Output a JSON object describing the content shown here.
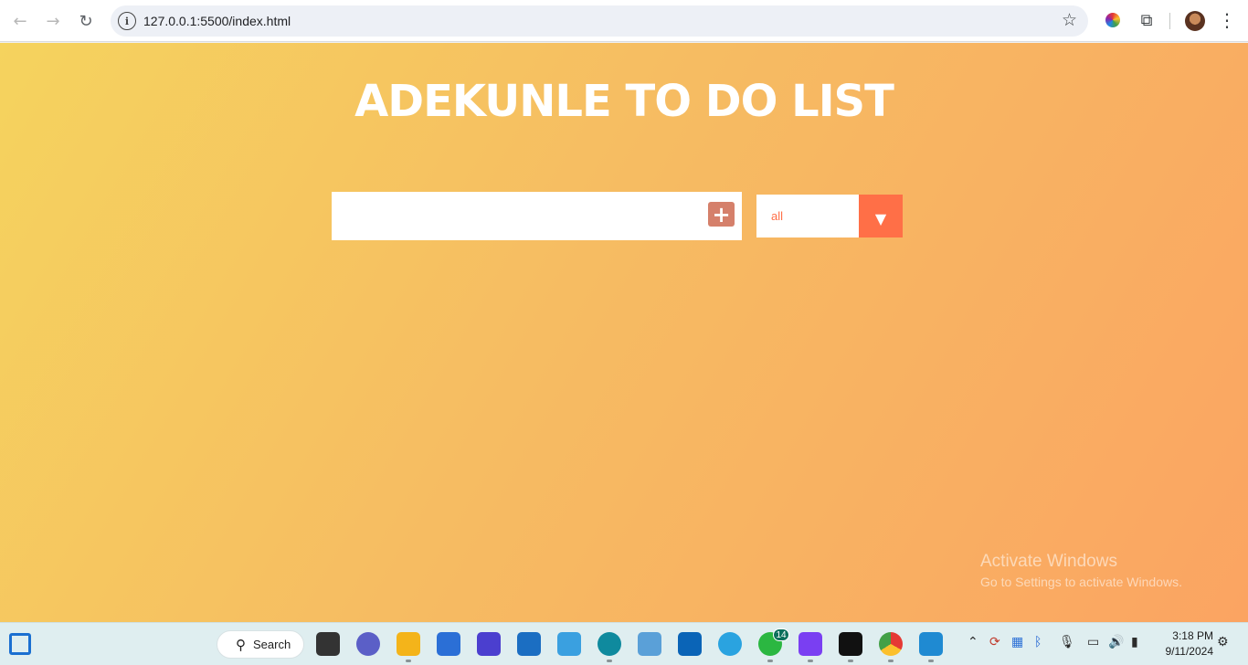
{
  "browser": {
    "url": "127.0.0.1:5500/index.html",
    "back_icon": "←",
    "forward_icon": "→",
    "reload_icon": "↻",
    "info_icon": "i",
    "star_icon": "☆",
    "puzzle_icon": "⧉",
    "menu_icon": "⋮"
  },
  "page": {
    "title": "ADEKUNLE TO DO LIST",
    "todo_input_value": "",
    "add_button_icon": "+",
    "filter_selected": "all",
    "filter_arrow": "▼"
  },
  "watermark": {
    "line1": "Activate Windows",
    "line2": "Go to Settings to activate Windows."
  },
  "taskbar": {
    "search_label": "Search",
    "search_icon": "⚲",
    "whatsapp_badge": "14",
    "time": "3:18 PM",
    "date": "9/11/2024"
  },
  "colors": {
    "accent": "#ff6f47",
    "add_button": "#d5806b",
    "gradient_start": "#f5d35e",
    "gradient_end": "#fba462"
  }
}
